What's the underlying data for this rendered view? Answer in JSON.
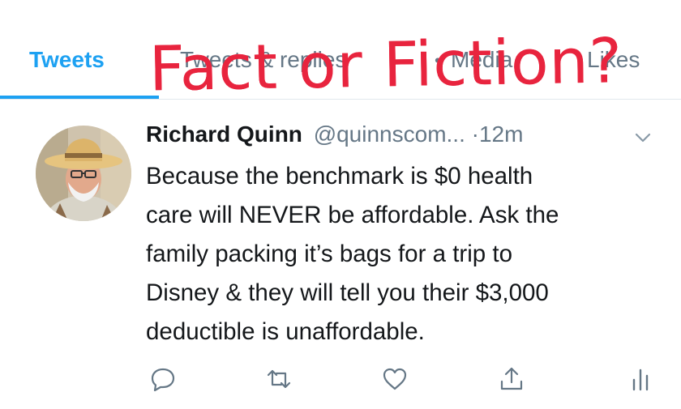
{
  "tabs": {
    "items": [
      {
        "label": "Tweets",
        "active": true
      },
      {
        "label": "Tweets & replies",
        "active": false
      },
      {
        "label": "Media",
        "active": false
      },
      {
        "label": "Likes",
        "active": false
      }
    ]
  },
  "overlay": {
    "text": "Fact or Fiction?",
    "color": "#e8243e"
  },
  "tweet": {
    "author_name": "Richard Quinn",
    "handle": "@quinnscom...",
    "time": "·12m",
    "lines": [
      "Because the benchmark is $0 health",
      "care will NEVER be affordable. Ask the",
      "family packing it’s bags for a trip to",
      "Disney & they will tell you their $3,000",
      "deductible is unaffordable."
    ]
  },
  "actions": {
    "icons": [
      "reply-icon",
      "retweet-icon",
      "like-icon",
      "share-icon",
      "analytics-icon"
    ]
  },
  "colors": {
    "accent": "#1da1f2",
    "muted": "#657786",
    "text": "#14171a"
  }
}
